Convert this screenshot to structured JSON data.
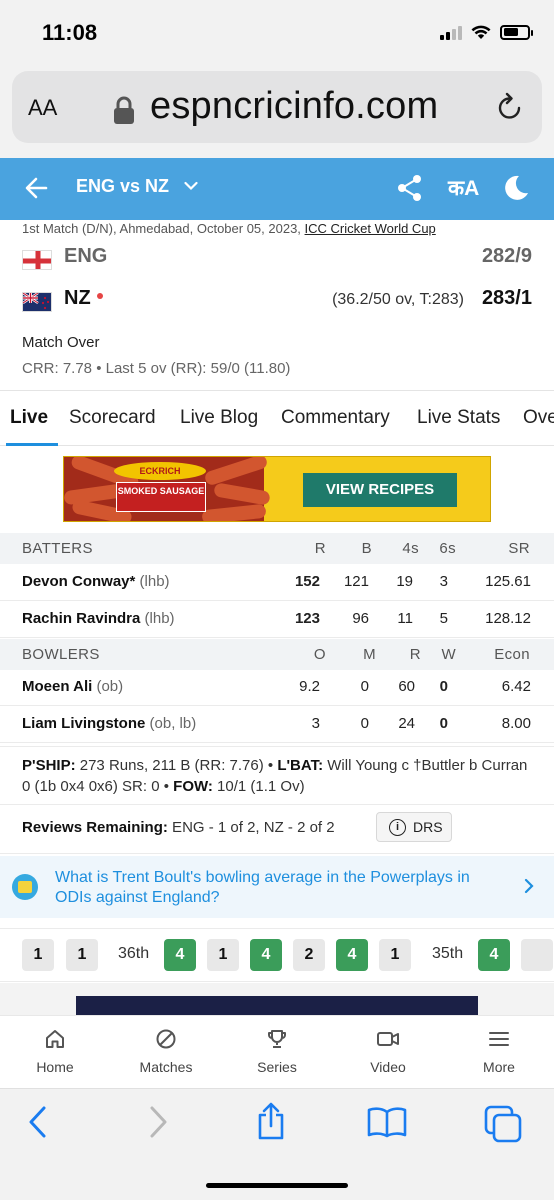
{
  "status_bar": {
    "time": "11:08"
  },
  "browser": {
    "text_size_label": "AA",
    "url": "espncricinfo.com"
  },
  "header": {
    "title": "ENG vs NZ",
    "lang_label": "कA"
  },
  "match": {
    "meta_prefix": "1st Match (D/N), Ahmedabad, October 05, 2023, ",
    "meta_link": "ICC Cricket World Cup",
    "teams": [
      {
        "name": "ENG",
        "score": "282/9"
      },
      {
        "name": "NZ",
        "overs": "(36.2/50 ov, T:283)",
        "score": "283/1"
      }
    ],
    "status": "Match Over",
    "crr": "CRR: 7.78 • Last 5 ov (RR): 59/0 (11.80)"
  },
  "tabs": [
    "Live",
    "Scorecard",
    "Live Blog",
    "Commentary",
    "Live Stats",
    "Ove"
  ],
  "ad": {
    "brand": "ECKRICH",
    "product": "SMOKED SAUSAGE",
    "button": "VIEW RECIPES"
  },
  "batters": {
    "headers": [
      "BATTERS",
      "R",
      "B",
      "4s",
      "6s",
      "SR"
    ],
    "rows": [
      {
        "name": "Devon Conway*",
        "hand": "(lhb)",
        "r": "152",
        "b": "121",
        "fours": "19",
        "sixes": "3",
        "sr": "125.61"
      },
      {
        "name": "Rachin Ravindra",
        "hand": "(lhb)",
        "r": "123",
        "b": "96",
        "fours": "11",
        "sixes": "5",
        "sr": "128.12"
      }
    ]
  },
  "bowlers": {
    "headers": [
      "BOWLERS",
      "O",
      "M",
      "R",
      "W",
      "Econ"
    ],
    "rows": [
      {
        "name": "Moeen Ali",
        "hand": "(ob)",
        "o": "9.2",
        "m": "0",
        "r": "60",
        "w": "0",
        "econ": "6.42"
      },
      {
        "name": "Liam Livingstone",
        "hand": "(ob, lb)",
        "o": "3",
        "m": "0",
        "r": "24",
        "w": "0",
        "econ": "8.00"
      }
    ]
  },
  "partnership": {
    "pship_label": "P'SHIP:",
    "pship_value": " 273 Runs, 211 B (RR: 7.76) • ",
    "lbat_label": "L'BAT:",
    "lbat_value": " Will Young c †Buttler b Curran 0 (1b 0x4 0x6) SR: 0 • ",
    "fow_label": "FOW:",
    "fow_value": " 10/1 (1.1 Ov)"
  },
  "reviews": {
    "label": "Reviews Remaining:",
    "value": " ENG - 1 of 2, NZ - 2 of 2",
    "drs_label": "DRS"
  },
  "question": "What is Trent Boult's bowling average in the Powerplays in ODIs against England?",
  "ball_feed": {
    "items": [
      {
        "kind": "ball",
        "value": "1"
      },
      {
        "kind": "ball",
        "value": "1"
      },
      {
        "kind": "over",
        "value": "36th"
      },
      {
        "kind": "four",
        "value": "4"
      },
      {
        "kind": "ball",
        "value": "1"
      },
      {
        "kind": "four",
        "value": "4"
      },
      {
        "kind": "ball",
        "value": "2"
      },
      {
        "kind": "four",
        "value": "4"
      },
      {
        "kind": "ball",
        "value": "1"
      },
      {
        "kind": "over",
        "value": "35th"
      },
      {
        "kind": "four",
        "value": "4"
      },
      {
        "kind": "ball",
        "value": ""
      }
    ]
  },
  "bottom_nav": [
    "Home",
    "Matches",
    "Series",
    "Video",
    "More"
  ],
  "colors": {
    "header_blue": "#4aa3df",
    "accent": "#1e8fde",
    "four_green": "#3b9d5a"
  }
}
